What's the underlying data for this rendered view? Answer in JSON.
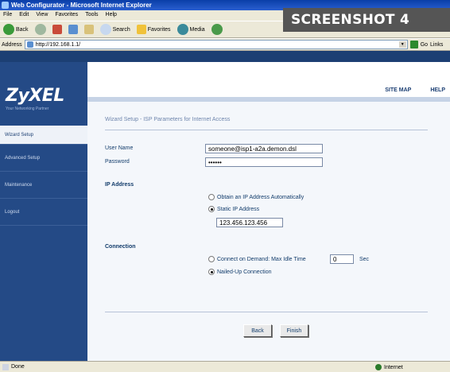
{
  "window": {
    "title": "Web Configurator - Microsoft Internet Explorer"
  },
  "overlay_label": "SCREENSHOT 4",
  "menu": [
    "File",
    "Edit",
    "View",
    "Favorites",
    "Tools",
    "Help"
  ],
  "toolbar": {
    "back_label": "Back",
    "search_label": "Search",
    "favorites_label": "Favorites",
    "media_label": "Media"
  },
  "address": {
    "label": "Address",
    "url": "http://192.168.1.1/",
    "go_label": "Go",
    "links_label": "Links"
  },
  "brand": {
    "logo": "ZyXEL",
    "tagline": "Your Networking Partner"
  },
  "header_links": [
    "SITE MAP",
    "HELP"
  ],
  "nav": [
    "Wizard Setup",
    "Advanced Setup",
    "Maintenance",
    "Logout"
  ],
  "page_title": "Wizard Setup - ISP Parameters for Internet Access",
  "form": {
    "username_label": "User Name",
    "username_value": "someone@isp1-a2a.demon.dsl",
    "password_label": "Password",
    "password_value": "••••••",
    "ip_section": "IP Address",
    "ip_option_auto": "Obtain an IP Address Automatically",
    "ip_option_static": "Static IP Address",
    "ip_value": "123.456.123.456",
    "connection_section": "Connection",
    "conn_option_demand": "Connect on Demand: Max Idle Time",
    "idle_value": "0",
    "idle_unit": "Sec",
    "conn_option_nailed": "Nailed-Up Connection"
  },
  "buttons": {
    "back": "Back",
    "finish": "Finish"
  },
  "status": {
    "left": "Done",
    "right": "Internet"
  }
}
